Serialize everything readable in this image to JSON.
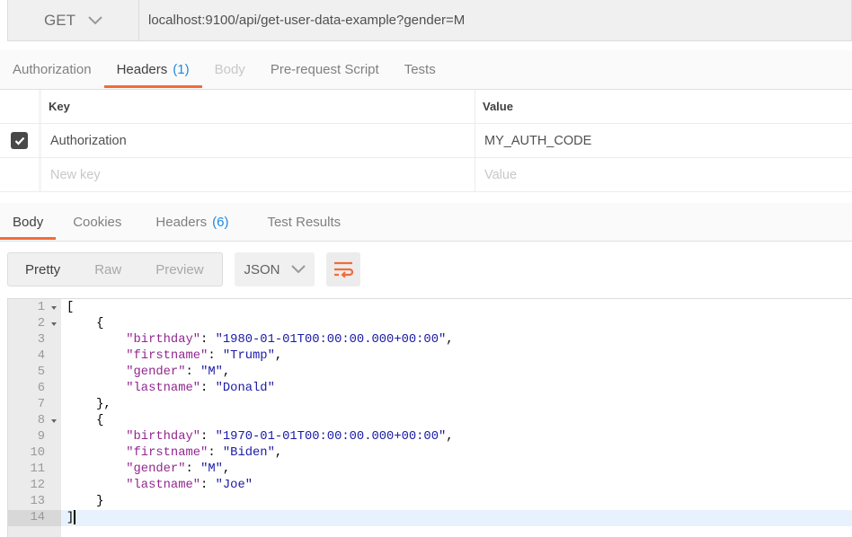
{
  "request": {
    "method": "GET",
    "url": "localhost:9100/api/get-user-data-example?gender=M"
  },
  "request_tabs": [
    {
      "label": "Authorization"
    },
    {
      "label": "Headers",
      "count": "(1)"
    },
    {
      "label": "Body"
    },
    {
      "label": "Pre-request Script"
    },
    {
      "label": "Tests"
    }
  ],
  "headers_table": {
    "key_header": "Key",
    "value_header": "Value",
    "rows": [
      {
        "key": "Authorization",
        "value": "MY_AUTH_CODE",
        "checked": true
      }
    ],
    "key_placeholder": "New key",
    "value_placeholder": "Value"
  },
  "response_tabs": [
    {
      "label": "Body"
    },
    {
      "label": "Cookies"
    },
    {
      "label": "Headers",
      "count": "(6)"
    },
    {
      "label": "Test Results"
    }
  ],
  "view_modes": [
    "Pretty",
    "Raw",
    "Preview"
  ],
  "format": "JSON",
  "colors": {
    "accent": "#f26b3a",
    "count": "#1e88e5",
    "key": "#92278f",
    "string": "#1a1aa6"
  },
  "code_lines": [
    [
      [
        "p",
        "["
      ]
    ],
    [
      [
        "p",
        "    {"
      ]
    ],
    [
      [
        "p",
        "        "
      ],
      [
        "k",
        "\"birthday\""
      ],
      [
        "p",
        ": "
      ],
      [
        "s",
        "\"1980-01-01T00:00:00.000+00:00\""
      ],
      [
        "p",
        ","
      ]
    ],
    [
      [
        "p",
        "        "
      ],
      [
        "k",
        "\"firstname\""
      ],
      [
        "p",
        ": "
      ],
      [
        "s",
        "\"Trump\""
      ],
      [
        "p",
        ","
      ]
    ],
    [
      [
        "p",
        "        "
      ],
      [
        "k",
        "\"gender\""
      ],
      [
        "p",
        ": "
      ],
      [
        "s",
        "\"M\""
      ],
      [
        "p",
        ","
      ]
    ],
    [
      [
        "p",
        "        "
      ],
      [
        "k",
        "\"lastname\""
      ],
      [
        "p",
        ": "
      ],
      [
        "s",
        "\"Donald\""
      ]
    ],
    [
      [
        "p",
        "    },"
      ]
    ],
    [
      [
        "p",
        "    {"
      ]
    ],
    [
      [
        "p",
        "        "
      ],
      [
        "k",
        "\"birthday\""
      ],
      [
        "p",
        ": "
      ],
      [
        "s",
        "\"1970-01-01T00:00:00.000+00:00\""
      ],
      [
        "p",
        ","
      ]
    ],
    [
      [
        "p",
        "        "
      ],
      [
        "k",
        "\"firstname\""
      ],
      [
        "p",
        ": "
      ],
      [
        "s",
        "\"Biden\""
      ],
      [
        "p",
        ","
      ]
    ],
    [
      [
        "p",
        "        "
      ],
      [
        "k",
        "\"gender\""
      ],
      [
        "p",
        ": "
      ],
      [
        "s",
        "\"M\""
      ],
      [
        "p",
        ","
      ]
    ],
    [
      [
        "p",
        "        "
      ],
      [
        "k",
        "\"lastname\""
      ],
      [
        "p",
        ": "
      ],
      [
        "s",
        "\"Joe\""
      ]
    ],
    [
      [
        "p",
        "    }"
      ]
    ],
    [
      [
        "p",
        "]"
      ]
    ]
  ],
  "foldable_lines": [
    1,
    2,
    8
  ],
  "current_line": 14
}
